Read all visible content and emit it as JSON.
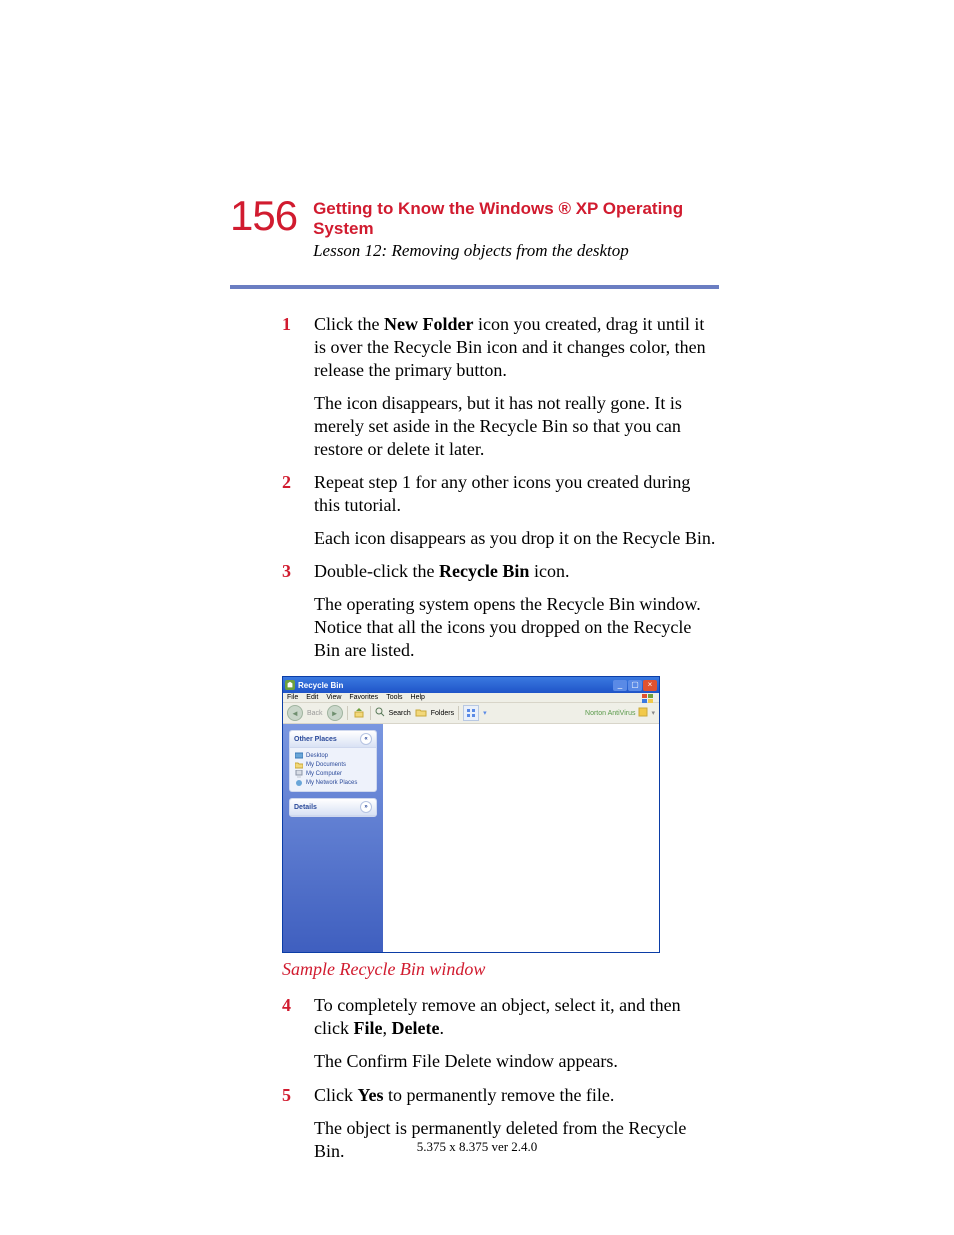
{
  "page_number": "156",
  "header": {
    "chapter_title": "Getting to Know the Windows ® XP Operating System",
    "lesson_title": "Lesson 12: Removing objects from the desktop"
  },
  "steps": {
    "s1": {
      "num": "1",
      "p1a": "Click the ",
      "p1b": "New Folder",
      "p1c": " icon you created, drag it until it is over the Recycle Bin icon and it changes color, then release the primary button.",
      "p2": "The icon disappears, but it has not really gone. It is merely set aside in the Recycle Bin so that you can restore or delete it later."
    },
    "s2": {
      "num": "2",
      "p1": "Repeat step 1 for any other icons you created during this tutorial.",
      "p2": "Each icon disappears as you drop it on the Recycle Bin."
    },
    "s3": {
      "num": "3",
      "p1a": "Double-click the ",
      "p1b": "Recycle Bin",
      "p1c": " icon.",
      "p2": "The operating system opens the Recycle Bin window. Notice that all the icons you dropped on the Recycle Bin are listed."
    },
    "s4": {
      "num": "4",
      "p1a": "To completely remove an object, select it, and then click ",
      "p1b": "File",
      "p1c": ", ",
      "p1d": "Delete",
      "p1e": ".",
      "p2": "The Confirm File Delete window appears."
    },
    "s5": {
      "num": "5",
      "p1a": "Click ",
      "p1b": "Yes",
      "p1c": " to permanently remove the file.",
      "p2": "The object is permanently deleted from the Recycle Bin."
    }
  },
  "caption": "Sample Recycle Bin window",
  "footer": "5.375 x 8.375 ver 2.4.0",
  "xp": {
    "title": "Recycle Bin",
    "menu": {
      "file": "File",
      "edit": "Edit",
      "view": "View",
      "favorites": "Favorites",
      "tools": "Tools",
      "help": "Help"
    },
    "toolbar": {
      "back": "Back",
      "search": "Search",
      "folders": "Folders",
      "norton": "Norton AntiVirus"
    },
    "panels": {
      "other": "Other Places",
      "desktop": "Desktop",
      "mydocs": "My Documents",
      "mycomp": "My Computer",
      "mynet": "My Network Places",
      "details": "Details"
    }
  }
}
